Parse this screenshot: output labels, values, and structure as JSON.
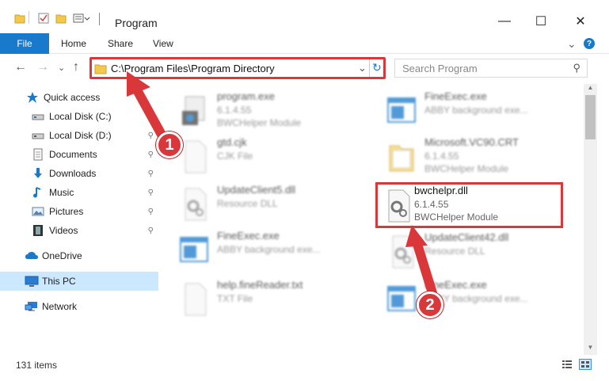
{
  "window": {
    "title": "Program",
    "minimize_glyph": "—",
    "maximize_glyph": "☐",
    "close_glyph": "✕"
  },
  "ribbon": {
    "tabs": [
      "File",
      "Home",
      "Share",
      "View"
    ],
    "expand_glyph": "⌄",
    "help_glyph": "?"
  },
  "nav": {
    "back_glyph": "←",
    "forward_glyph": "→",
    "recent_glyph": "⌄",
    "up_glyph": "↑",
    "address": "C:\\Program Files\\Program Directory",
    "refresh_glyph": "↻",
    "search_placeholder": "Search Program",
    "search_glyph": "⚲"
  },
  "sidebar": {
    "items": [
      {
        "label": "Quick access",
        "icon": "star-icon"
      },
      {
        "label": "Local Disk (C:)",
        "icon": "drive-icon",
        "pinned": true
      },
      {
        "label": "Local Disk (D:)",
        "icon": "drive-icon",
        "pinned": true
      },
      {
        "label": "Documents",
        "icon": "documents-icon",
        "pinned": true
      },
      {
        "label": "Downloads",
        "icon": "download-icon",
        "pinned": true
      },
      {
        "label": "Music",
        "icon": "music-icon",
        "pinned": true
      },
      {
        "label": "Pictures",
        "icon": "pictures-icon",
        "pinned": true
      },
      {
        "label": "Videos",
        "icon": "videos-icon",
        "pinned": true
      },
      {
        "label": "OneDrive",
        "icon": "cloud-icon"
      },
      {
        "label": "This PC",
        "icon": "computer-icon",
        "selected": true
      },
      {
        "label": "Network",
        "icon": "network-icon"
      }
    ],
    "pin_glyph": "📌"
  },
  "files": [
    {
      "name": "program.exe",
      "line2": "6.1.4.55",
      "line3": "BWCHelper Module",
      "icon": "exe-icon"
    },
    {
      "name": "FineExec.exe",
      "line2": "ABBY background exe...",
      "line3": "",
      "icon": "window-icon"
    },
    {
      "name": "gtd.cjk",
      "line2": "CJK File",
      "line3": "",
      "icon": "blank-file-icon"
    },
    {
      "name": "Microsoft.VC90.CRT",
      "line2": "6.1.4.55",
      "line3": "BWCHelper Module",
      "icon": "folder-icon"
    },
    {
      "name": "UpdateClient5.dll",
      "line2": "Resource DLL",
      "line3": "",
      "icon": "dll-icon"
    },
    {
      "name": "bwchelpr.dll",
      "line2": "6.1.4.55",
      "line3": "BWCHelper Module",
      "icon": "dll-icon",
      "highlighted": true
    },
    {
      "name": "FineExec.exe",
      "line2": "ABBY background exe...",
      "line3": "",
      "icon": "window-icon"
    },
    {
      "name": "UpdateClient42.dll",
      "line2": "Resource DLL",
      "line3": "",
      "icon": "dll-icon"
    },
    {
      "name": "help.fineReader.txt",
      "line2": "TXT File",
      "line3": "",
      "icon": "blank-file-icon"
    },
    {
      "name": "FineExec.exe",
      "line2": "ABBY background exe...",
      "line3": "",
      "icon": "window-icon"
    }
  ],
  "status": {
    "item_count": "131 items"
  },
  "callouts": [
    "1",
    "2"
  ],
  "colors": {
    "accent": "#1979ca",
    "highlight_red": "#d9373a",
    "selected_bg": "#cce8ff"
  }
}
